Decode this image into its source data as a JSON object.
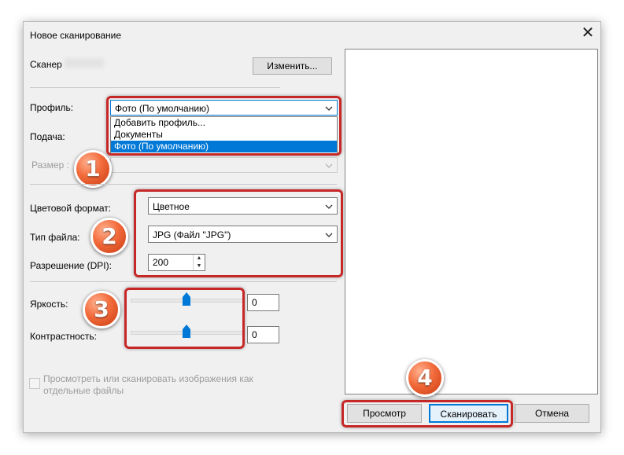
{
  "dialog": {
    "title": "Новое сканирование",
    "close_icon": "close-icon"
  },
  "scanner": {
    "label": "Сканер",
    "change_button": "Изменить..."
  },
  "profile": {
    "label": "Профиль:",
    "value": "Фото (По умолчанию)",
    "options": [
      "Добавить профиль...",
      "Документы",
      "Фото (По умолчанию)"
    ],
    "selected_index": 2
  },
  "source": {
    "label": "Подача:"
  },
  "size": {
    "label": "Размер",
    "suffix": ":"
  },
  "color_format": {
    "label": "Цветовой формат:",
    "value": "Цветное"
  },
  "file_type": {
    "label": "Тип файла:",
    "value": "JPG (Файл \"JPG\")"
  },
  "resolution": {
    "label": "Разрешение (DPI):",
    "value": "200"
  },
  "brightness": {
    "label": "Яркость:",
    "value": "0",
    "level": 0.5
  },
  "contrast": {
    "label": "Контрастность:",
    "value": "0",
    "level": 0.5
  },
  "separate_files": {
    "line1": "Просмотреть или сканировать изображения как",
    "line2": "отдельные файлы",
    "checked": false
  },
  "buttons": {
    "preview": "Просмотр",
    "scan": "Сканировать",
    "cancel": "Отмена"
  },
  "badges": [
    "1",
    "2",
    "3",
    "4"
  ],
  "colors": {
    "highlight": "#c62828",
    "selection": "#0078d7",
    "badge": "#f26a3a",
    "slider_thumb": "#0078d7"
  }
}
